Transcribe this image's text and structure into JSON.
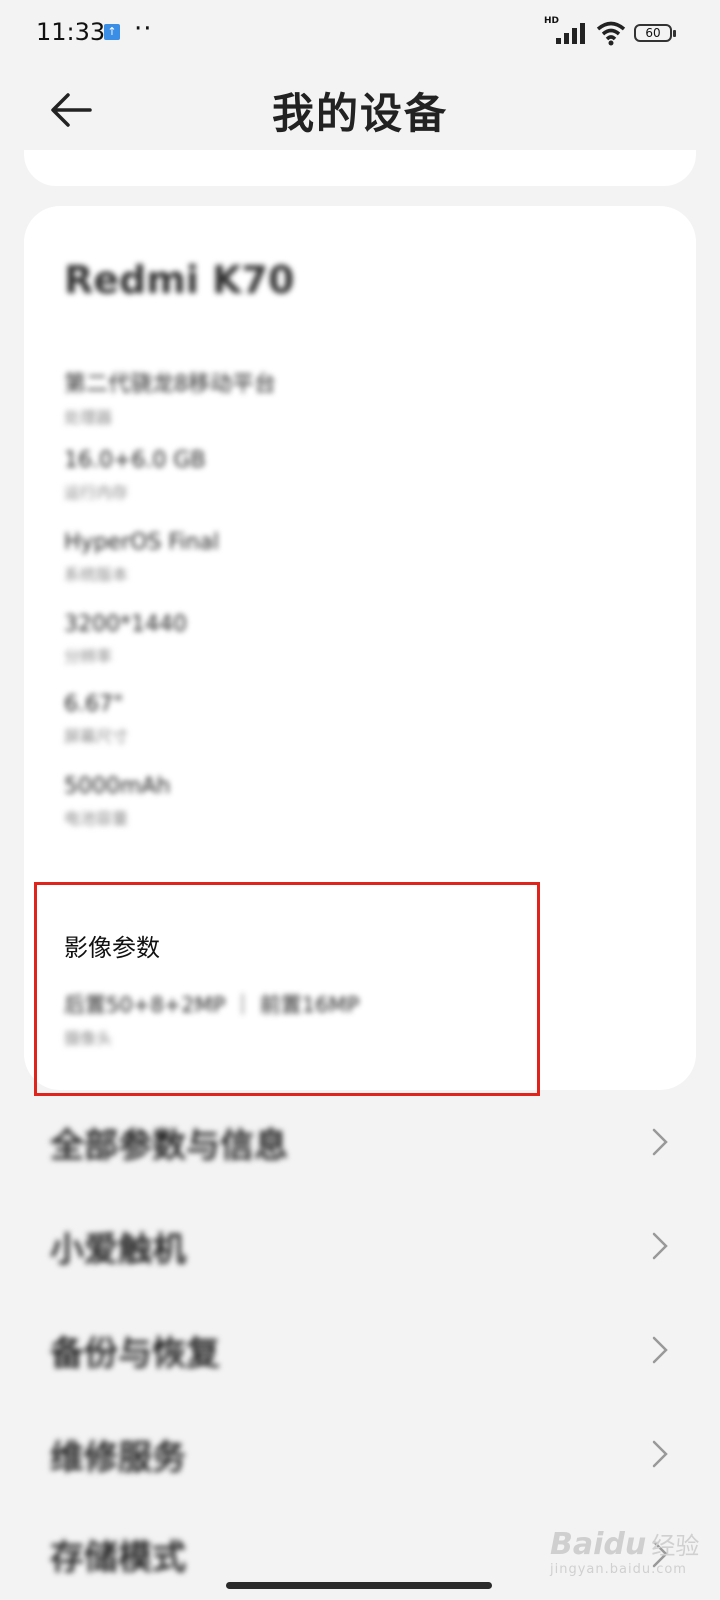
{
  "status_bar": {
    "time": "11:33",
    "notification_dots": "··",
    "network_badge": "HD",
    "battery_level": "60"
  },
  "header": {
    "title": "我的设备"
  },
  "device_card": {
    "model_name": "Redmi K70",
    "specs": [
      {
        "value": "第二代骁龙8移动平台",
        "label": "处理器"
      },
      {
        "value": "16.0+6.0 GB",
        "label": "运行内存"
      },
      {
        "value": "HyperOS Final",
        "label": "系统版本"
      },
      {
        "value": "3200*1440",
        "label": "分辨率"
      },
      {
        "value": "6.67\"",
        "label": "屏幕尺寸"
      },
      {
        "value": "5000mAh",
        "label": "电池容量"
      }
    ],
    "imaging": {
      "title": "影像参数",
      "value": "后置50+8+2MP ｜ 前置16MP",
      "label": "摄像头"
    }
  },
  "menu": [
    {
      "label": "全部参数与信息"
    },
    {
      "label": "小爱触机"
    },
    {
      "label": "备份与恢复"
    },
    {
      "label": "维修服务"
    },
    {
      "label": "存储模式"
    }
  ],
  "watermark": {
    "brand": "Baidu",
    "brand_cn": "经验",
    "url": "jingyan.baidu.com"
  }
}
